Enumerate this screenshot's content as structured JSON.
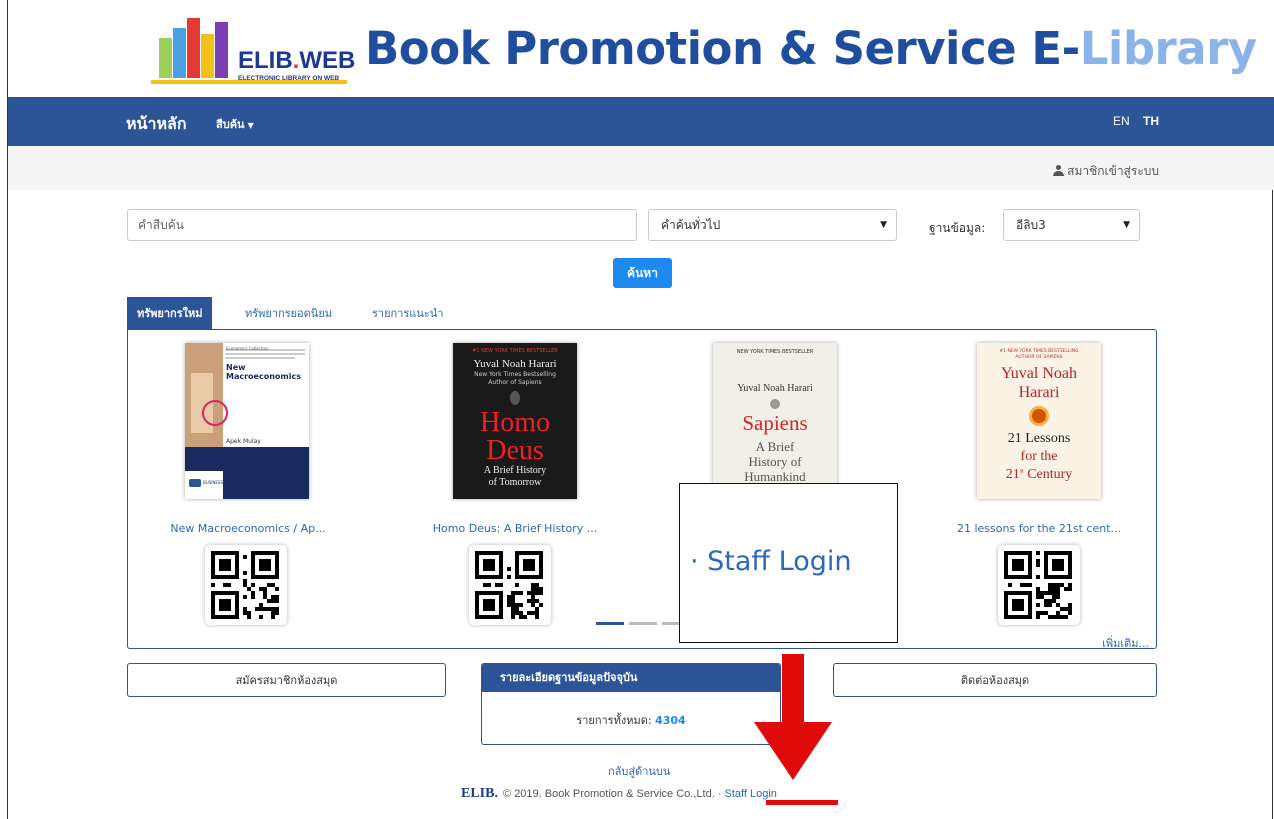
{
  "header": {
    "logo_text": "ELIB",
    "logo_text_end": "WEB",
    "logo_sub": "ELECTRONIC LIBRARY ON WEB",
    "title_main": "Book Promotion & Service E-",
    "title_highlight": "Library"
  },
  "navbar": {
    "home": "หน้าหลัก",
    "search": "สืบค้น",
    "lang_en": "EN",
    "lang_th": "TH"
  },
  "member": {
    "login": "สมาชิกเข้าสู่ระบบ"
  },
  "search": {
    "placeholder": "คำสืบค้น",
    "type_value": "คำค้นทั่วไป",
    "db_label": "ฐานข้อมูล:",
    "db_value": "อีลิบ3",
    "button": "ค้นหา"
  },
  "tabs": [
    "ทรัพยากรใหม่",
    "ทรัพยากรยอดนิยม",
    "รายการแนะนำ"
  ],
  "books": [
    {
      "title": "New Macroeconomics / Ap..."
    },
    {
      "title": "Homo Deus: A Brief History ..."
    },
    {
      "title": ""
    },
    {
      "title": "21 lessons for the 21st cent..."
    }
  ],
  "covers": {
    "b1": {
      "publisher": "Economics Collection",
      "title": "New Macroeconomics",
      "author": "Apek Mulay",
      "imprint": "BUSINESS EXPERT PRESS"
    },
    "b2": {
      "badge": "#1 NEW YORK TIMES BESTSELLER",
      "author": "Yuval Noah Harari",
      "note": "New York Times Bestselling",
      "note2": "Author of Sapiens",
      "title1": "Homo",
      "title2": "Deus",
      "sub1": "A Brief History",
      "sub2": "of Tomorrow"
    },
    "b3": {
      "badge": "NEW YORK TIMES BESTSELLER",
      "author": "Yuval Noah Harari",
      "title": "Sapiens",
      "sub1": "A Brief",
      "sub2": "History of",
      "sub3": "Humankind"
    },
    "b4": {
      "badge": "#1 NEW YORK TIMES BESTSELLING",
      "badge2": "AUTHOR OF SAPIENS",
      "author1": "Yuval Noah",
      "author2": "Harari",
      "t1": "21 Lessons",
      "t2": "for the",
      "t3": "21",
      "t3sup": "st",
      "t4": "Century"
    }
  },
  "more": "เพิ่มเติม...",
  "callout": "· Staff Login",
  "bottom": {
    "register": "สมัครสมาชิกห้องสมุด",
    "info_title": "รายละเอียดฐานข้อมูลปัจจุบัน",
    "total_label": "รายการทั้งหมด:",
    "total_value": "4304",
    "contact": "ติดต่อห้องสมุด"
  },
  "footer": {
    "back_top": "กลับสู่ด้านบน",
    "brand": "ELIB.",
    "copyright": "© 2019. Book Promotion & Service Co.,Ltd. ",
    "staff": "· Staff Login"
  },
  "colors": {
    "navbar": "#2c5597",
    "accent": "#1d8af0",
    "link": "#2c68b8",
    "arrow": "#e10a0a"
  }
}
